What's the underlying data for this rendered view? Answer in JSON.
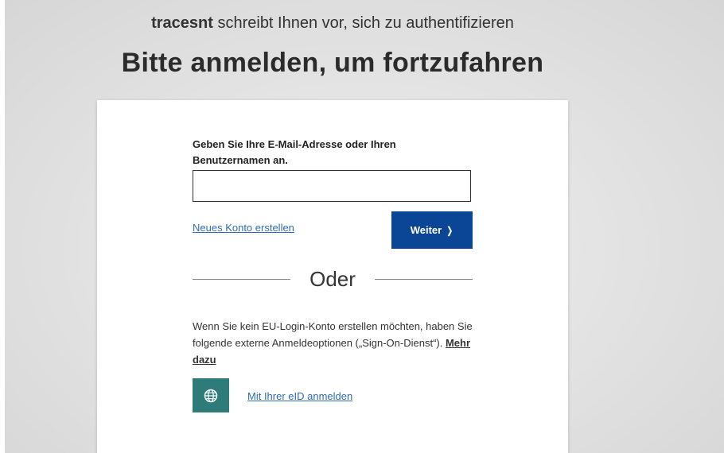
{
  "header": {
    "app_name": "tracesnt",
    "subtitle_rest": " schreibt Ihnen vor, sich zu authentifizieren",
    "title": "Bitte anmelden, um fortzufahren"
  },
  "login": {
    "field_label": "Geben Sie Ihre E-Mail-Adresse oder Ihren Benutzernamen an.",
    "field_value": "",
    "create_account_link": "Neues Konto erstellen",
    "next_button_label": "Weiter",
    "next_button_chevron": "❭"
  },
  "divider": {
    "label": "Oder"
  },
  "external": {
    "description": "Wenn Sie kein EU-Login-Konto erstellen möchten, haben Sie folgende externe Anmeldeoptionen („Sign-On-Dienst“). ",
    "more_link": "Mehr dazu",
    "eid_icon": "globe-icon",
    "eid_link": "Mit Ihrer eID anmelden"
  },
  "colors": {
    "primary_button": "#0b4595",
    "eid_icon_bg": "#2e7c7a",
    "link": "#2f6db5"
  }
}
